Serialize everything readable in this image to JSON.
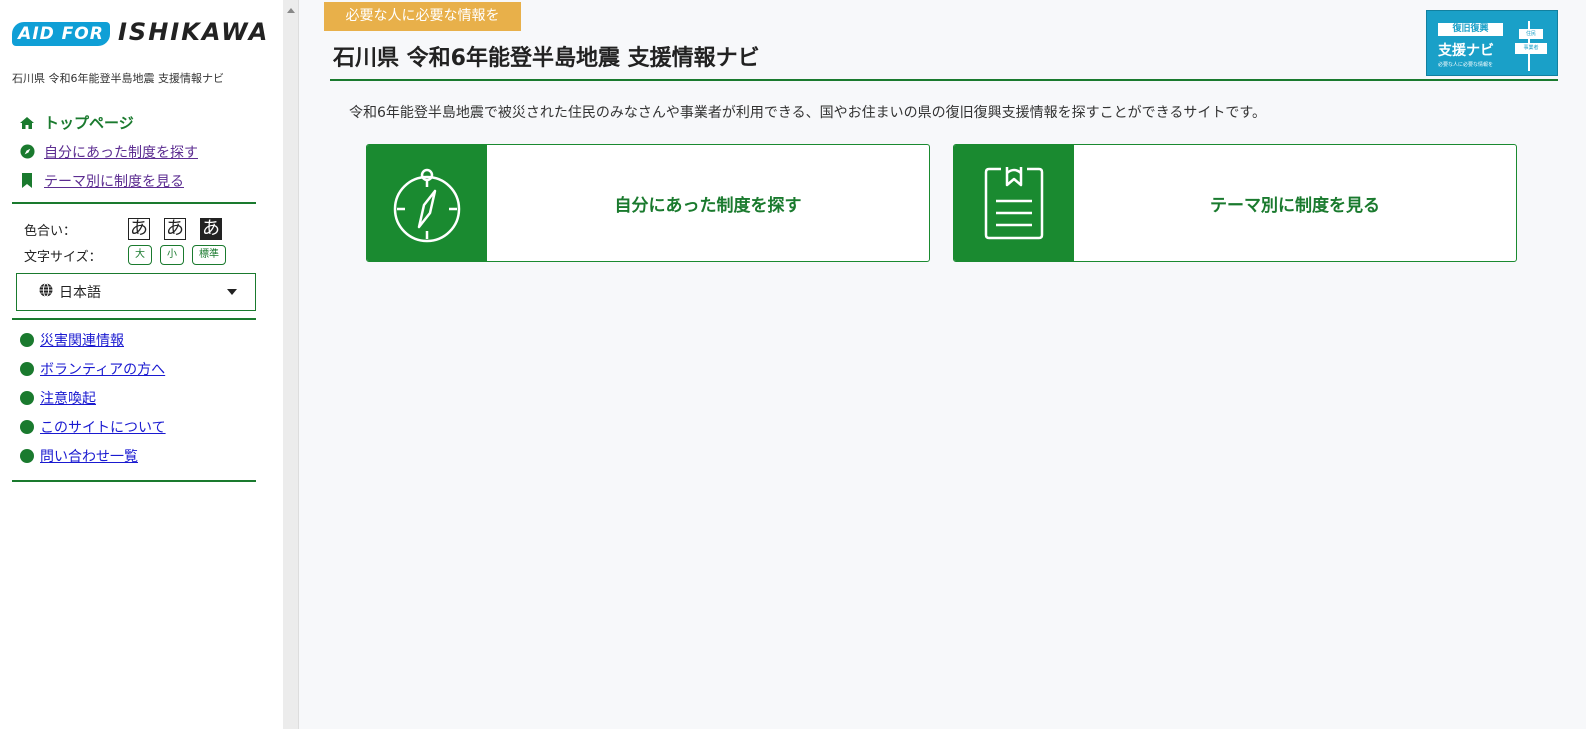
{
  "sidebar": {
    "logo_left": "AID FOR",
    "logo_right": "ISHIKAWA",
    "site_sub": "石川県 令和6年能登半島地震 支援情報ナビ",
    "nav": [
      {
        "label": "トップページ",
        "icon": "home-icon"
      },
      {
        "label": "自分にあった制度を探す",
        "icon": "compass-icon"
      },
      {
        "label": "テーマ別に制度を見る",
        "icon": "bookmark-icon"
      }
    ],
    "color_label": "色合い：",
    "color_options": [
      "あ",
      "あ",
      "あ"
    ],
    "size_label": "文字サイズ：",
    "size_options": [
      "大",
      "小",
      "標準"
    ],
    "language": "日本語",
    "links": [
      "災害関連情報",
      "ボランティアの方へ",
      "注意喚起",
      "このサイトについて",
      "問い合わせ一覧"
    ]
  },
  "main": {
    "tagline": "必要な人に必要な情報を",
    "title": "石川県 令和6年能登半島地震 支援情報ナビ",
    "description": "令和6年能登半島地震で被災された住民のみなさんや事業者が利用できる、国やお住まいの県の復旧復興支援情報を探すことができるサイトです。",
    "badge": {
      "top": "復旧復興",
      "middle": "支援ナビ",
      "bottom": "必要な人に必要な情報を",
      "sign1": "住民",
      "sign2": "事業者"
    },
    "cards": [
      {
        "label": "自分にあった制度を探す",
        "icon": "compass-icon"
      },
      {
        "label": "テーマ別に制度を見る",
        "icon": "clipboard-icon"
      }
    ]
  },
  "colors": {
    "accent_green": "#1a8a30",
    "tagline_orange": "#e8b04a",
    "badge_blue": "#1aa0c8"
  }
}
